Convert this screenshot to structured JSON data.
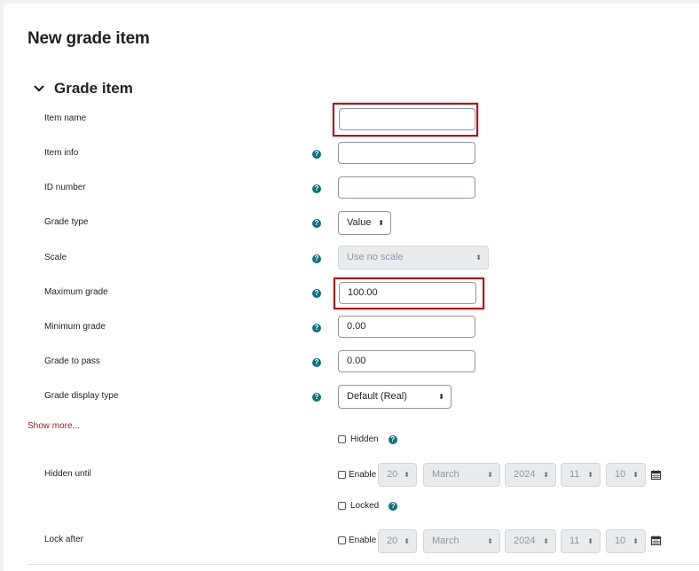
{
  "page": {
    "title": "New grade item"
  },
  "section": {
    "title": "Grade item"
  },
  "fields": {
    "item_name": {
      "label": "Item name",
      "value": ""
    },
    "item_info": {
      "label": "Item info",
      "value": ""
    },
    "id_number": {
      "label": "ID number",
      "value": ""
    },
    "grade_type": {
      "label": "Grade type",
      "value": "Value"
    },
    "scale": {
      "label": "Scale",
      "value": "Use no scale"
    },
    "maximum_grade": {
      "label": "Maximum grade",
      "value": "100.00"
    },
    "minimum_grade": {
      "label": "Minimum grade",
      "value": "0.00"
    },
    "grade_to_pass": {
      "label": "Grade to pass",
      "value": "0.00"
    },
    "grade_display_type": {
      "label": "Grade display type",
      "value": "Default (Real)"
    }
  },
  "show_more": "Show more...",
  "hidden": {
    "label": "Hidden"
  },
  "hidden_until": {
    "label": "Hidden until",
    "enable": "Enable",
    "day": "20",
    "month": "March",
    "year": "2024",
    "hour": "11",
    "minute": "10"
  },
  "locked": {
    "label": "Locked"
  },
  "lock_after": {
    "label": "Lock after",
    "enable": "Enable",
    "day": "20",
    "month": "March",
    "year": "2024",
    "hour": "11",
    "minute": "10"
  },
  "icons": {
    "help": "?",
    "arrows": "⬍"
  },
  "colors": {
    "help_icon": "#11707e",
    "highlight_border": "#a8161c",
    "link": "#8f1d1d"
  }
}
